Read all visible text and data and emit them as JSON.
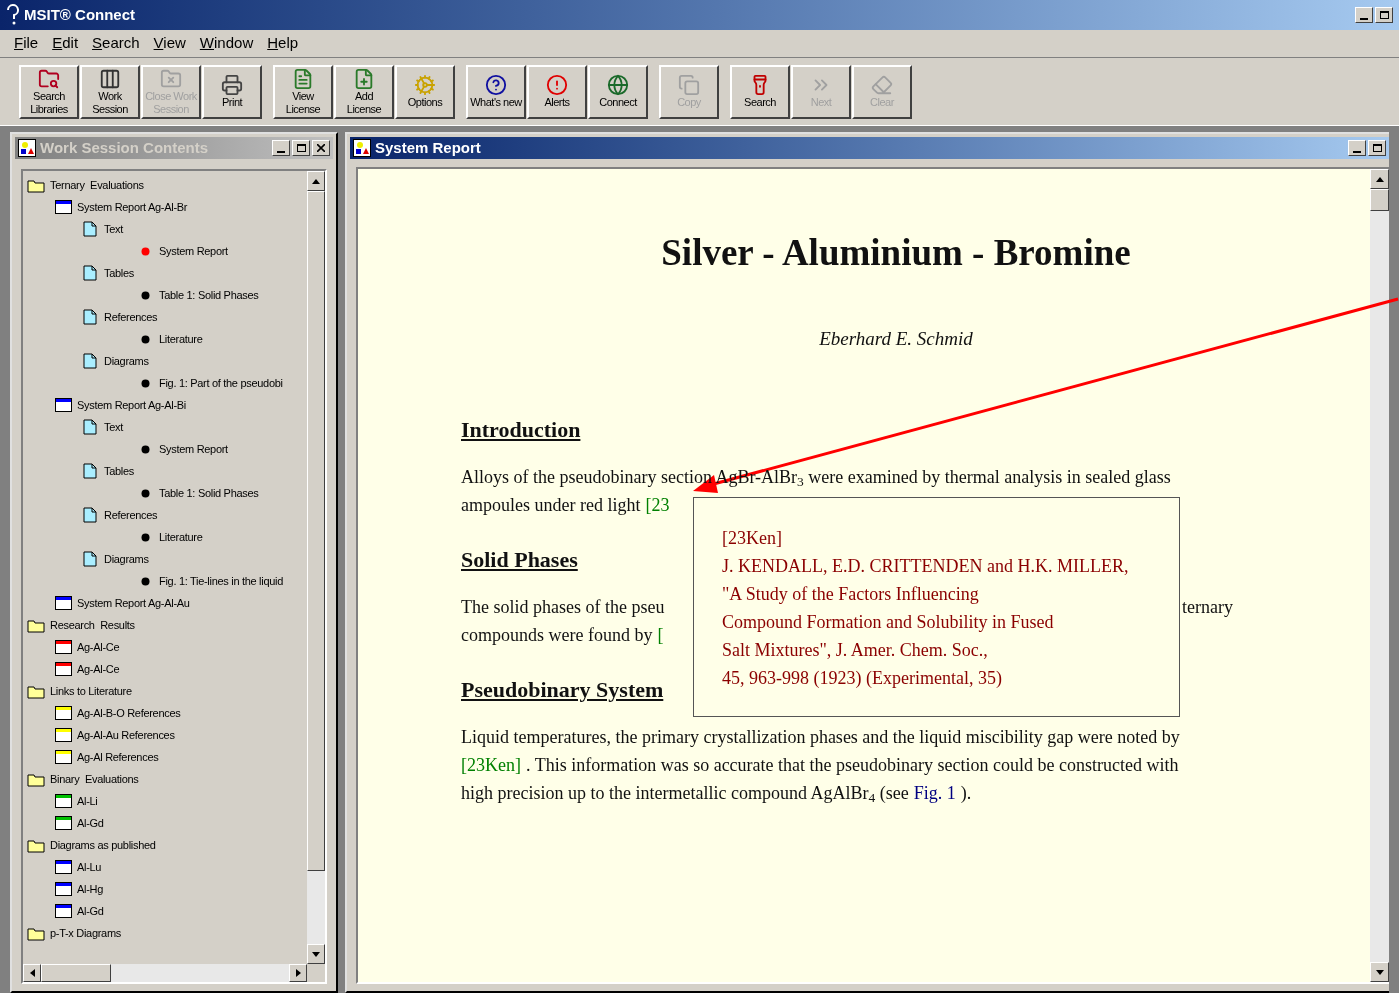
{
  "window": {
    "title": "MSIT® Connect"
  },
  "menu": [
    {
      "label": "File"
    },
    {
      "label": "Edit"
    },
    {
      "label": "Search"
    },
    {
      "label": "View"
    },
    {
      "label": "Window"
    },
    {
      "label": "Help"
    }
  ],
  "toolbar": [
    [
      {
        "lines": [
          "Search",
          "Libraries"
        ],
        "disabled": false
      },
      {
        "lines": [
          "Work",
          "Session"
        ],
        "disabled": false
      },
      {
        "lines": [
          "Close Work",
          "Session"
        ],
        "disabled": true
      },
      {
        "lines": [
          "Print"
        ],
        "disabled": false
      }
    ],
    [
      {
        "lines": [
          "View",
          "License"
        ],
        "disabled": false
      },
      {
        "lines": [
          "Add",
          "License"
        ],
        "disabled": false
      },
      {
        "lines": [
          "Options"
        ],
        "disabled": false
      }
    ],
    [
      {
        "lines": [
          "What's new"
        ],
        "disabled": false
      },
      {
        "lines": [
          "Alerts"
        ],
        "disabled": false
      },
      {
        "lines": [
          "Connect"
        ],
        "disabled": false
      }
    ],
    [
      {
        "lines": [
          "Copy"
        ],
        "disabled": true
      }
    ],
    [
      {
        "lines": [
          "Search"
        ],
        "disabled": false
      },
      {
        "lines": [
          "Next"
        ],
        "disabled": true
      },
      {
        "lines": [
          "Clear"
        ],
        "disabled": true
      }
    ]
  ],
  "session_window": {
    "title": "Work Session Contents",
    "active": false,
    "tree": [
      {
        "kind": "folder",
        "label": "Ternary  Evaluations",
        "children": [
          {
            "kind": "report",
            "color": "#0000ff",
            "label": "System Report Ag-Al-Br",
            "children": [
              {
                "kind": "page",
                "label": "Text",
                "children": [
                  {
                    "kind": "item",
                    "color": "#ff0000",
                    "label": "System Report"
                  }
                ]
              },
              {
                "kind": "page",
                "label": "Tables",
                "children": [
                  {
                    "kind": "item",
                    "color": "#000000",
                    "label": "Table 1: Solid Phases"
                  }
                ]
              },
              {
                "kind": "page",
                "label": "References",
                "children": [
                  {
                    "kind": "item",
                    "color": "#000000",
                    "label": "Literature"
                  }
                ]
              },
              {
                "kind": "page",
                "label": "Diagrams",
                "children": [
                  {
                    "kind": "item",
                    "color": "#000000",
                    "label": "Fig. 1: Part of the pseudobi"
                  }
                ]
              }
            ]
          },
          {
            "kind": "report",
            "color": "#0000ff",
            "label": "System Report Ag-Al-Bi",
            "children": [
              {
                "kind": "page",
                "label": "Text",
                "children": [
                  {
                    "kind": "item",
                    "color": "#000000",
                    "label": "System Report"
                  }
                ]
              },
              {
                "kind": "page",
                "label": "Tables",
                "children": [
                  {
                    "kind": "item",
                    "color": "#000000",
                    "label": "Table 1: Solid Phases"
                  }
                ]
              },
              {
                "kind": "page",
                "label": "References",
                "children": [
                  {
                    "kind": "item",
                    "color": "#000000",
                    "label": "Literature"
                  }
                ]
              },
              {
                "kind": "page",
                "label": "Diagrams",
                "children": [
                  {
                    "kind": "item",
                    "color": "#000000",
                    "label": "Fig. 1: Tie-lines in the liquid"
                  }
                ]
              }
            ]
          },
          {
            "kind": "report",
            "color": "#0000ff",
            "label": "System Report Ag-Al-Au"
          }
        ]
      },
      {
        "kind": "folder",
        "label": "Research  Results",
        "children": [
          {
            "kind": "report",
            "color": "#ff0000",
            "label": "Ag-Al-Ce"
          },
          {
            "kind": "report",
            "color": "#ff0000",
            "label": "Ag-Al-Ce"
          }
        ]
      },
      {
        "kind": "folder",
        "label": "Links to Literature",
        "children": [
          {
            "kind": "report",
            "color": "#ffff00",
            "label": "Ag-Al-B-O References"
          },
          {
            "kind": "report",
            "color": "#ffff00",
            "label": "Ag-Al-Au References"
          },
          {
            "kind": "report",
            "color": "#ffff00",
            "label": "Ag-Al References"
          }
        ]
      },
      {
        "kind": "folder",
        "label": "Binary  Evaluations",
        "children": [
          {
            "kind": "report",
            "color": "#00c000",
            "label": "Al-Li"
          },
          {
            "kind": "report",
            "color": "#00c000",
            "label": "Al-Gd"
          }
        ]
      },
      {
        "kind": "folder",
        "label": "Diagrams as published",
        "children": [
          {
            "kind": "report",
            "color": "#0000ff",
            "label": "Al-Lu"
          },
          {
            "kind": "report",
            "color": "#0000ff",
            "label": "Al-Hg"
          },
          {
            "kind": "report",
            "color": "#0000ff",
            "label": "Al-Gd"
          }
        ]
      },
      {
        "kind": "folder",
        "label": "p-T-x Diagrams"
      }
    ]
  },
  "report_window": {
    "title": "System Report",
    "active": true,
    "title_text": "Silver - Aluminium - Bromine",
    "author": "Eberhard E. Schmid",
    "sections": [
      {
        "heading": "Introduction",
        "lines": [
          {
            "segments": [
              {
                "kind": "text",
                "text": "Alloys of the pseudobinary section AgBr-AlBr$_{3}$ were examined by thermal analysis in sealed glass"
              }
            ]
          },
          {
            "segments": [
              {
                "kind": "text",
                "text": "ampoules under red light"
              },
              {
                "kind": "ref",
                "text": "[23"
              }
            ]
          }
        ]
      },
      {
        "heading": "Solid Phases",
        "lines": [
          {
            "segments": [
              {
                "kind": "text",
                "text": "The solid phases of the pseu"
              }
            ],
            "resume": [
              {
                "kind": "text",
                "text": "ternary"
              }
            ]
          },
          {
            "segments": [
              {
                "kind": "text",
                "text": "compounds were found by"
              },
              {
                "kind": "ref",
                "text": "["
              }
            ]
          }
        ]
      },
      {
        "heading": "Pseudobinary System",
        "lines": [
          {
            "segments": [
              {
                "kind": "text",
                "text": "Liquid temperatures, the primary crystallization phases and the liquid miscibility gap were noted by"
              }
            ]
          },
          {
            "segments": [
              {
                "kind": "ref",
                "text": "[23Ken]"
              },
              {
                "kind": "text",
                "text": ". This information was so accurate that the pseudobinary section could be constructed with"
              }
            ]
          },
          {
            "segments": [
              {
                "kind": "text",
                "text": "high precision up to the intermetallic compound AgAlBr$_{4}$ (see"
              },
              {
                "kind": "fig",
                "text": "Fig. 1"
              },
              {
                "kind": "text",
                "text": ")."
              }
            ]
          }
        ]
      }
    ],
    "popup": {
      "lines": [
        "[23Ken]",
        "J. KENDALL, E.D. CRITTENDEN and H.K. MILLER,",
        "\"A Study of the Factors Influencing",
        "Compound Formation and Solubility in Fused",
        "Salt Mixtures\", J. Amer. Chem. Soc.,",
        "45, 963-998 (1923) (Experimental, 35)"
      ]
    }
  }
}
